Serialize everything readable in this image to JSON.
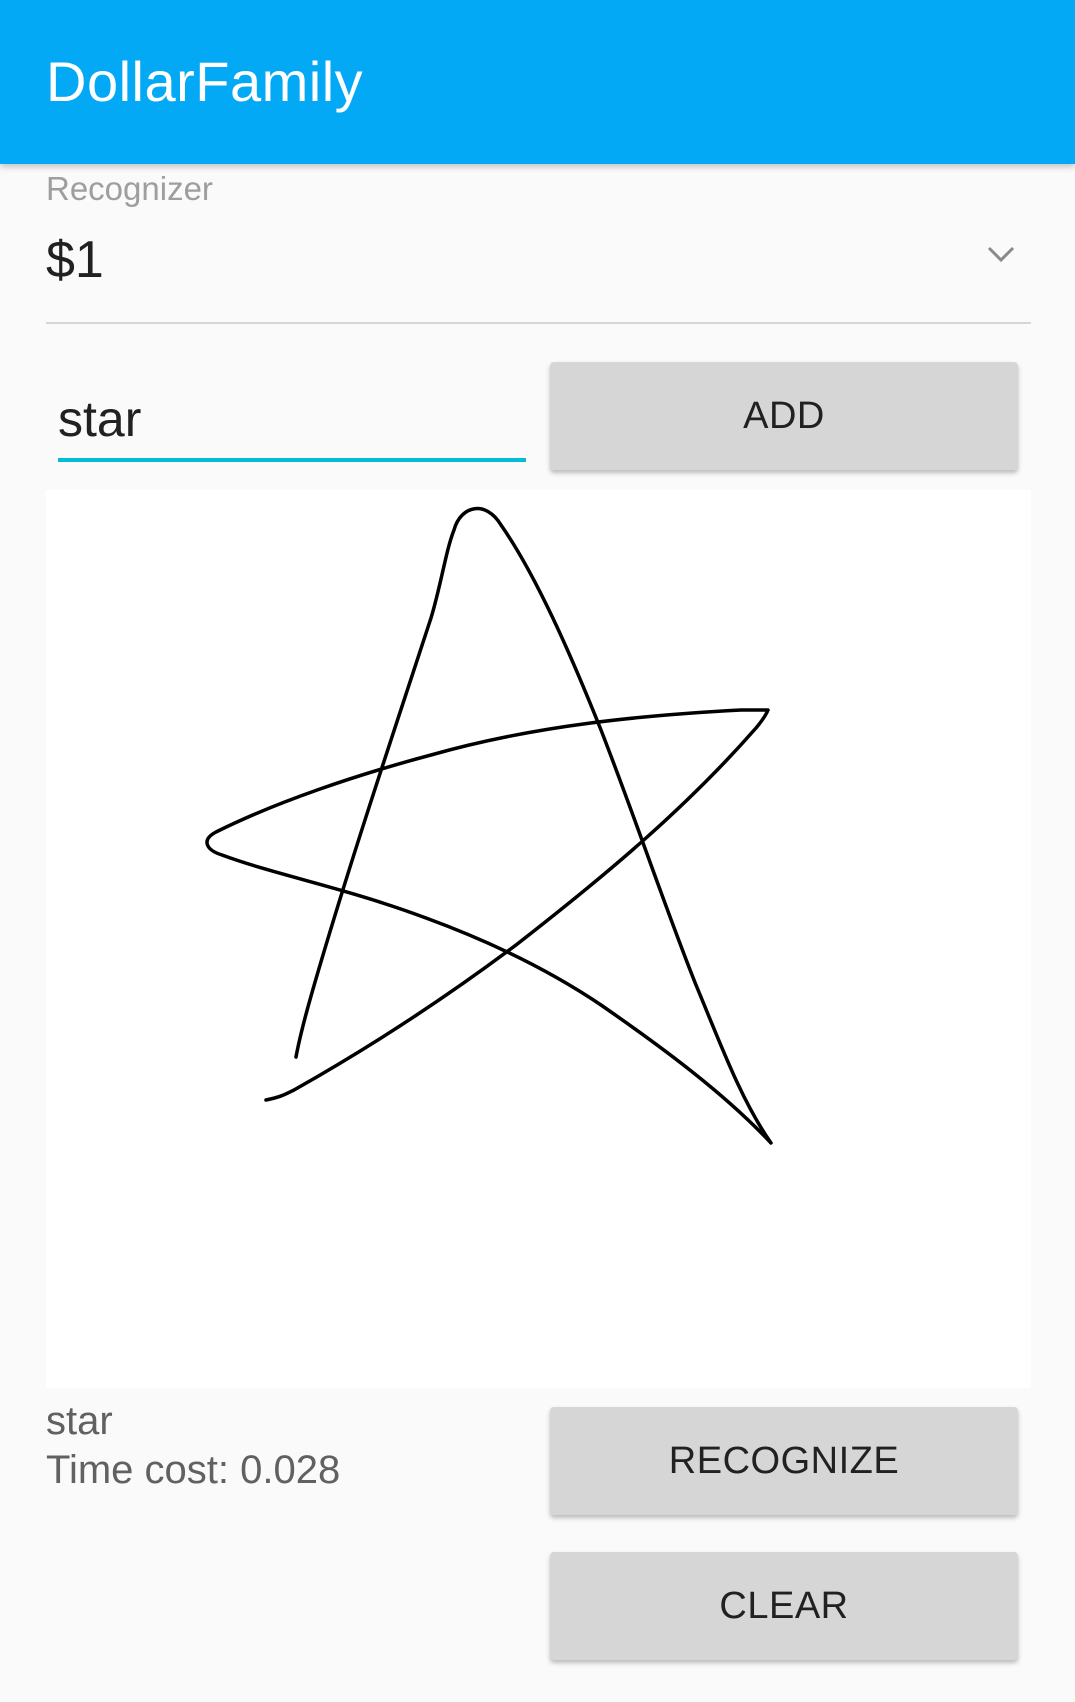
{
  "app_bar": {
    "title": "DollarFamily",
    "color": "#03a9f4"
  },
  "recognizer": {
    "label": "Recognizer",
    "selected": "$1",
    "icon": "chevron-down-icon"
  },
  "gesture_name_input": {
    "value": "star",
    "accent_color": "#00bcd4"
  },
  "buttons": {
    "add": "ADD",
    "recognize": "RECOGNIZE",
    "clear": "CLEAR"
  },
  "canvas": {
    "stroke": "hand-drawn star gesture",
    "stroke_color": "#000000"
  },
  "result": {
    "name": "star",
    "time_cost": "Time cost: 0.028"
  }
}
